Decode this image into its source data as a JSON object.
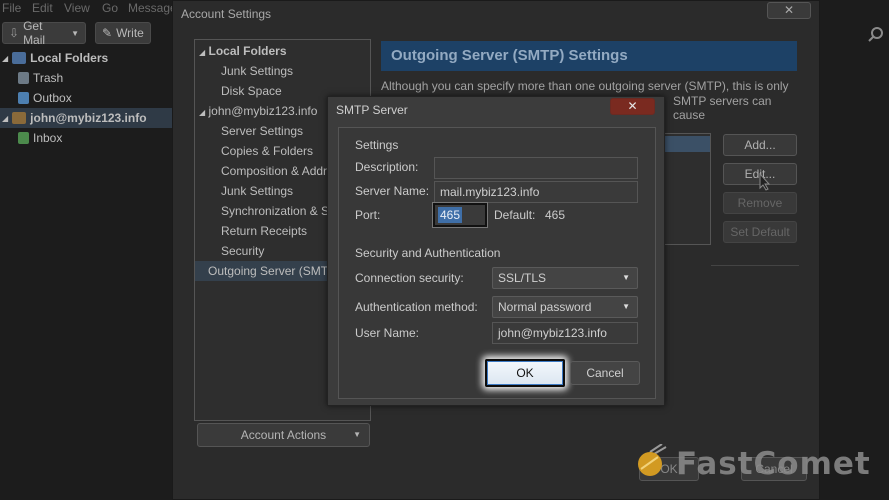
{
  "menubar": {
    "items": [
      "File",
      "Edit",
      "View",
      "Go",
      "Message"
    ]
  },
  "toolbar": {
    "get_mail": "Get Mail",
    "write": "Write"
  },
  "folders": {
    "local_folders": "Local Folders",
    "trash": "Trash",
    "outbox": "Outbox",
    "account": "john@mybiz123.info",
    "inbox": "Inbox"
  },
  "account_settings": {
    "title": "Account Settings",
    "close": "✕",
    "tree": {
      "local_folders": "Local Folders",
      "junk_settings": "Junk Settings",
      "disk_space": "Disk Space",
      "account": "john@mybiz123.info",
      "server_settings": "Server Settings",
      "copies_folders": "Copies & Folders",
      "composition": "Composition & Addressing",
      "junk_settings_2": "Junk Settings",
      "sync_storage": "Synchronization & Storage",
      "return_receipts": "Return Receipts",
      "security": "Security",
      "outgoing": "Outgoing Server (SMTP)"
    },
    "account_actions": "Account Actions",
    "smtp_header": "Outgoing Server (SMTP) Settings",
    "smtp_desc_1": "Although you can specify more than one outgoing server (SMTP), this is only",
    "smtp_desc_2": "SMTP servers can cause",
    "buttons": {
      "add": "Add...",
      "edit": "Edit...",
      "remove": "Remove",
      "set_default": "Set Default"
    },
    "ok": "OK",
    "cancel": "Cancel"
  },
  "smtp_dialog": {
    "title": "SMTP Server",
    "close": "✕",
    "settings_heading": "Settings",
    "description_label": "Description:",
    "description_value": "",
    "server_name_label": "Server Name:",
    "server_name_value": "mail.mybiz123.info",
    "port_label": "Port:",
    "port_value": "465",
    "default_label": "Default:",
    "default_value": "465",
    "security_heading": "Security and Authentication",
    "connection_security_label": "Connection security:",
    "connection_security_value": "SSL/TLS",
    "auth_method_label": "Authentication method:",
    "auth_method_value": "Normal password",
    "username_label": "User Name:",
    "username_value": "john@mybiz123.info",
    "ok": "OK",
    "cancel": "Cancel"
  },
  "watermark": {
    "text": "FastComet"
  },
  "colors": {
    "accent_header": "#1d4166",
    "selection": "#3f6fa8",
    "close_red": "#7a2a20",
    "logo_orange": "#e0a321"
  }
}
